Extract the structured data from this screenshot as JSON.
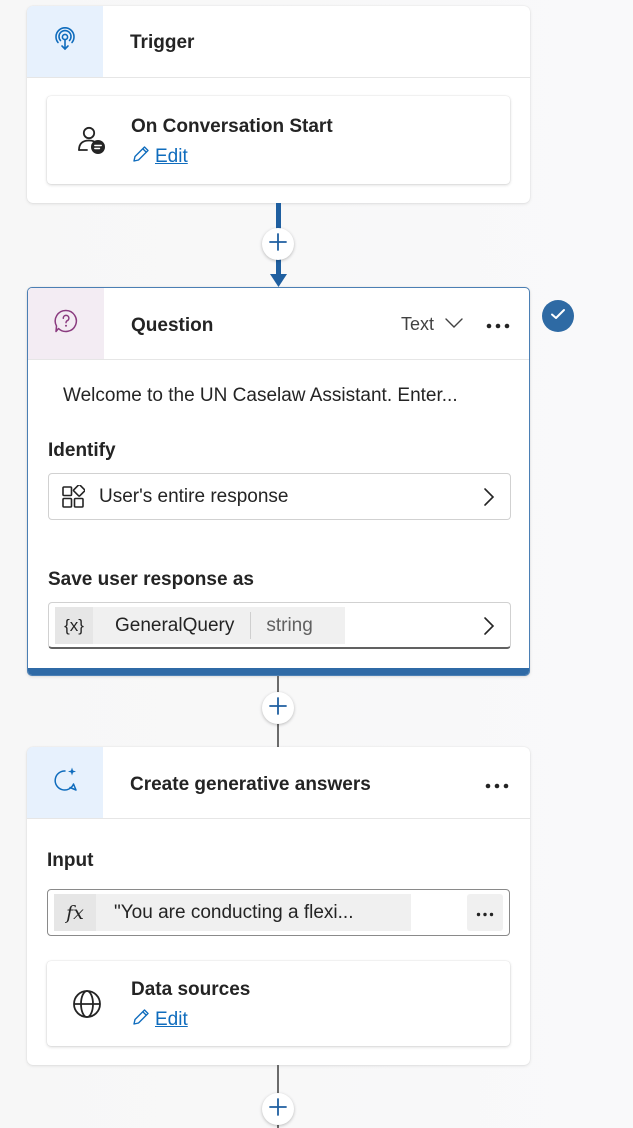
{
  "trigger": {
    "title": "Trigger",
    "event": {
      "title": "On Conversation Start",
      "edit_label": "Edit"
    }
  },
  "question": {
    "title": "Question",
    "type_label": "Text",
    "message": "Welcome to the UN Caselaw Assistant. Enter...",
    "identify": {
      "label": "Identify",
      "value": "User's entire response"
    },
    "save_as": {
      "label": "Save user response as",
      "variable_icon": "{x}",
      "variable_name": "GeneralQuery",
      "variable_type": "string"
    },
    "status": "check-icon"
  },
  "generative": {
    "title": "Create generative answers",
    "input": {
      "label": "Input",
      "fx_label": "fx",
      "value": "\"You are conducting a flexi..."
    },
    "data_sources": {
      "title": "Data sources",
      "edit_label": "Edit"
    }
  },
  "colors": {
    "accent": "#0f6cbd",
    "selected_border": "#2f6aa6",
    "trigger_tile": "#e7f1fd",
    "question_tile": "#f3ecf3"
  }
}
